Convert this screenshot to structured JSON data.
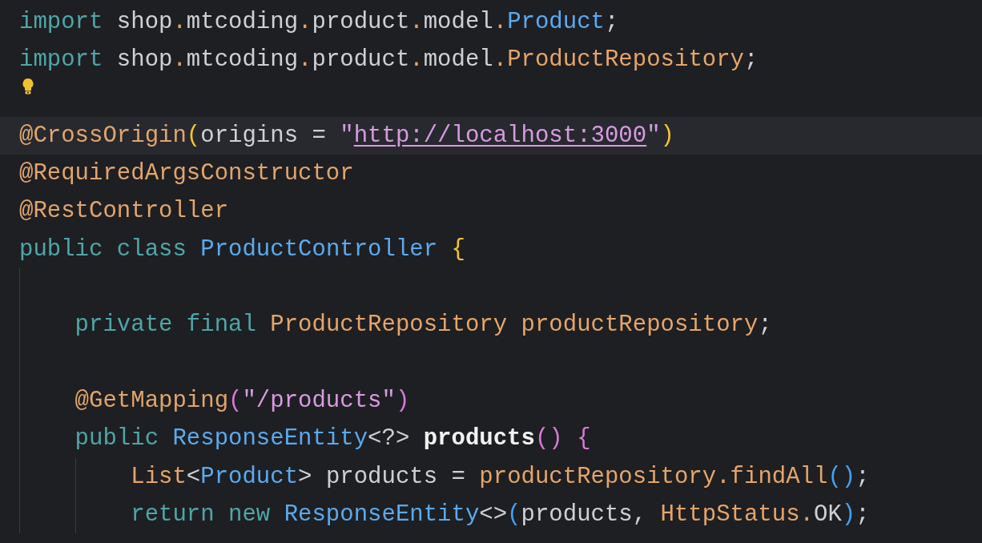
{
  "editor": {
    "lines": [
      {
        "tokens": [
          {
            "text": "import",
            "kind": "kw"
          },
          {
            "text": " shop",
            "kind": "plain"
          },
          {
            "text": ".",
            "kind": "op"
          },
          {
            "text": "mtcoding",
            "kind": "plain"
          },
          {
            "text": ".",
            "kind": "op"
          },
          {
            "text": "product",
            "kind": "plain"
          },
          {
            "text": ".",
            "kind": "op"
          },
          {
            "text": "model",
            "kind": "plain"
          },
          {
            "text": ".",
            "kind": "op"
          },
          {
            "text": "Product",
            "kind": "type"
          },
          {
            "text": ";",
            "kind": "plain"
          }
        ]
      },
      {
        "tokens": [
          {
            "text": "import",
            "kind": "kw"
          },
          {
            "text": " shop",
            "kind": "plain"
          },
          {
            "text": ".",
            "kind": "op"
          },
          {
            "text": "mtcoding",
            "kind": "plain"
          },
          {
            "text": ".",
            "kind": "op"
          },
          {
            "text": "product",
            "kind": "plain"
          },
          {
            "text": ".",
            "kind": "op"
          },
          {
            "text": "model",
            "kind": "plain"
          },
          {
            "text": ".",
            "kind": "op"
          },
          {
            "text": "ProductRepository",
            "kind": "cls"
          },
          {
            "text": ";",
            "kind": "plain"
          }
        ]
      },
      {
        "kind": "hint"
      },
      {
        "current": true,
        "tokens": [
          {
            "text": "@CrossOrigin",
            "kind": "ann"
          },
          {
            "text": "(",
            "kind": "p1"
          },
          {
            "text": "origins = ",
            "kind": "plain"
          },
          {
            "text": "\"",
            "kind": "str"
          },
          {
            "text": "http://localhost:3000",
            "kind": "link"
          },
          {
            "text": "\"",
            "kind": "str"
          },
          {
            "text": ")",
            "kind": "p1"
          }
        ]
      },
      {
        "tokens": [
          {
            "text": "@RequiredArgsConstructor",
            "kind": "ann"
          }
        ]
      },
      {
        "tokens": [
          {
            "text": "@RestController",
            "kind": "ann"
          }
        ]
      },
      {
        "tokens": [
          {
            "text": "public class ",
            "kind": "kw"
          },
          {
            "text": "ProductController ",
            "kind": "type"
          },
          {
            "text": "{",
            "kind": "p1"
          }
        ]
      },
      {
        "kind": "blank"
      },
      {
        "tokens": [
          {
            "text": "    private final ",
            "kind": "kw"
          },
          {
            "text": "ProductRepository productRepository",
            "kind": "cls"
          },
          {
            "text": ";",
            "kind": "plain"
          }
        ]
      },
      {
        "kind": "blank"
      },
      {
        "tokens": [
          {
            "text": "    @GetMapping",
            "kind": "ann"
          },
          {
            "text": "(",
            "kind": "p2"
          },
          {
            "text": "\"/products\"",
            "kind": "str"
          },
          {
            "text": ")",
            "kind": "p2"
          }
        ]
      },
      {
        "tokens": [
          {
            "text": "    public ",
            "kind": "kw"
          },
          {
            "text": "ResponseEntity",
            "kind": "type"
          },
          {
            "text": "<?> ",
            "kind": "plain"
          },
          {
            "text": "products",
            "kind": "decl"
          },
          {
            "text": "()",
            "kind": "p2"
          },
          {
            "text": " {",
            "kind": "p2"
          }
        ]
      },
      {
        "tokens": [
          {
            "text": "        List",
            "kind": "cls"
          },
          {
            "text": "<",
            "kind": "plain"
          },
          {
            "text": "Product",
            "kind": "type"
          },
          {
            "text": "> products = ",
            "kind": "plain"
          },
          {
            "text": "productRepository",
            "kind": "cls"
          },
          {
            "text": ".",
            "kind": "op"
          },
          {
            "text": "findAll",
            "kind": "cls"
          },
          {
            "text": "()",
            "kind": "p3"
          },
          {
            "text": ";",
            "kind": "plain"
          }
        ]
      },
      {
        "tokens": [
          {
            "text": "        return new ",
            "kind": "kw"
          },
          {
            "text": "ResponseEntity",
            "kind": "type"
          },
          {
            "text": "<>",
            "kind": "plain"
          },
          {
            "text": "(",
            "kind": "p3"
          },
          {
            "text": "products, ",
            "kind": "plain"
          },
          {
            "text": "HttpStatus",
            "kind": "cls"
          },
          {
            "text": ".",
            "kind": "op"
          },
          {
            "text": "OK",
            "kind": "plain"
          },
          {
            "text": ")",
            "kind": "p3"
          },
          {
            "text": ";",
            "kind": "plain"
          }
        ]
      }
    ]
  }
}
